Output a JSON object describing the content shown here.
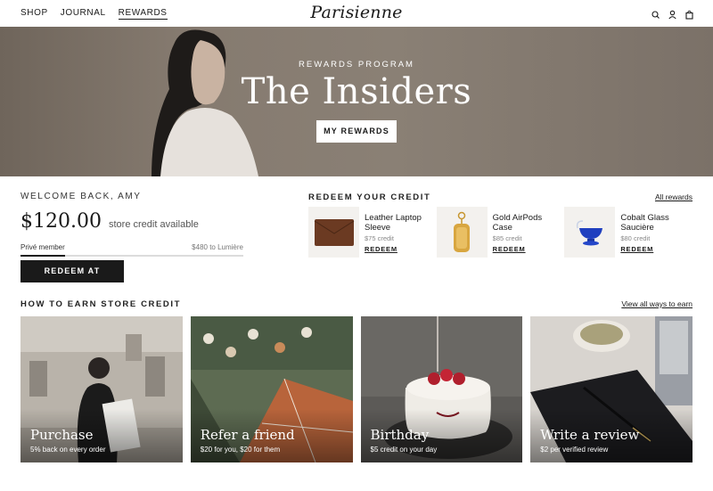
{
  "nav": {
    "links": [
      "SHOP",
      "JOURNAL",
      "REWARDS"
    ],
    "logo": "Parisienne",
    "icons": [
      "search-icon",
      "account-icon",
      "bag-icon"
    ]
  },
  "hero": {
    "kicker": "REWARDS PROGRAM",
    "title": "The Insiders",
    "button": "MY REWARDS"
  },
  "welcome": {
    "greeting": "WELCOME BACK, AMY",
    "balance": "$120.00",
    "balance_note": "store credit available",
    "tier": "Privé member",
    "next_tier": "$480 to Lumière",
    "progress": 0.2,
    "redeem_button": "REDEEM AT CHECKOUT"
  },
  "redeem": {
    "heading": "REDEEM YOUR CREDIT",
    "all_link": "All rewards",
    "products": [
      {
        "name": "Leather Laptop Sleeve",
        "price": "$75 credit",
        "link": "REDEEM"
      },
      {
        "name": "Gold AirPods Case",
        "price": "$85 credit",
        "link": "REDEEM"
      },
      {
        "name": "Cobalt Glass Saucière",
        "price": "$80 credit",
        "link": "REDEEM"
      }
    ]
  },
  "earn": {
    "heading": "HOW TO EARN STORE CREDIT",
    "all_link": "View all ways to earn",
    "tiles": [
      {
        "title": "Purchase",
        "sub": "5% back on every order"
      },
      {
        "title": "Refer a friend",
        "sub": "$20 for you, $20 for them"
      },
      {
        "title": "Birthday",
        "sub": "$5 credit on your day"
      },
      {
        "title": "Write a review",
        "sub": "$2 per verified review"
      }
    ]
  },
  "colors": {
    "accent": "#1a1a1a",
    "hero_bg": "#857a6f",
    "thumb_bg": "#f3f1ee"
  }
}
